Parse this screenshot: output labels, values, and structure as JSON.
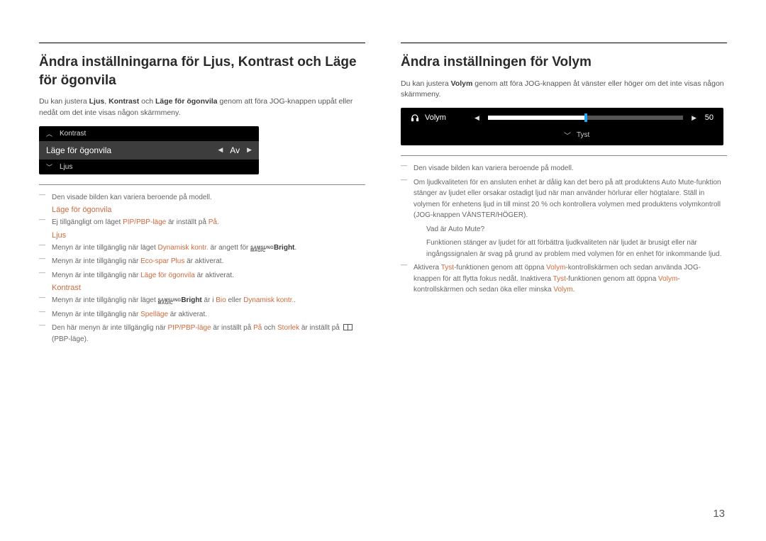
{
  "page_number": "13",
  "left": {
    "heading": "Ändra inställningarna för Ljus, Kontrast och Läge för ögonvila",
    "intro_parts": {
      "a": "Du kan justera ",
      "ljus": "Ljus",
      "sep1": ", ",
      "kontrast": "Kontrast",
      "sep2": " och ",
      "lfo": "Läge för ögonvila",
      "b": " genom att föra JOG-knappen uppåt eller nedåt om det inte visas någon skärmmeny."
    },
    "osd": {
      "top": "Kontrast",
      "mid": "Läge för ögonvila",
      "mid_val": "Av",
      "bottom": "Ljus"
    },
    "note_same": "Den visade bilden kan variera beroende på modell.",
    "sh_eye": "Läge för ögonvila",
    "eye_note": {
      "a": "Ej tillgängligt om läget ",
      "hl1": "PIP/PBP-läge",
      "b": " är inställt på ",
      "hl2": "På",
      "c": "."
    },
    "sh_ljus": "Ljus",
    "ljus_n1": {
      "a": "Menyn är inte tillgänglig när läget ",
      "hl1": "Dynamisk kontr.",
      "b": " är angett för ",
      "brand": "Bright",
      "c": "."
    },
    "ljus_n2": {
      "a": "Menyn är inte tillgänglig när ",
      "hl1": "Eco-spar Plus",
      "b": " är aktiverat."
    },
    "ljus_n3": {
      "a": "Menyn är inte tillgänglig när ",
      "hl1": "Läge för ögonvila",
      "b": " är aktiverat."
    },
    "sh_kon": "Kontrast",
    "kon_n1": {
      "a": "Menyn är inte tillgänglig när läget ",
      "brand": "Bright",
      "b": " är i ",
      "hl1": "Bio",
      "c": " eller ",
      "hl2": "Dynamisk kontr.",
      "d": "."
    },
    "kon_n2": {
      "a": "Menyn är inte tillgänglig när ",
      "hl1": "Spelläge",
      "b": " är aktiverat."
    },
    "kon_n3": {
      "a": "Den här menyn är inte tillgänglig när ",
      "hl1": "PIP/PBP-läge",
      "b": " är inställt på ",
      "hl2": "På",
      "c": " och ",
      "hl3": "Storlek",
      "d": " är inställt på ",
      "e": " (PBP-läge)."
    }
  },
  "right": {
    "heading": "Ändra inställningen för Volym",
    "intro_parts": {
      "a": "Du kan justera ",
      "hl": "Volym",
      "b": " genom att föra JOG-knappen åt vänster eller höger om det inte visas någon skärmmeny."
    },
    "osd": {
      "label": "Volym",
      "value": "50",
      "mute": "Tyst"
    },
    "note_same": "Den visade bilden kan variera beroende på modell.",
    "n2": "Om ljudkvaliteten för en ansluten enhet är dålig kan det bero på att produktens Auto Mute-funktion stänger av ljudet eller orsakar ostadigt ljud när man använder hörlurar eller högtalare. Ställ in volymen för enhetens ljud in till minst 20 % och kontrollera volymen med produktens volymkontroll (JOG-knappen VÄNSTER/HÖGER).",
    "n2a": "Vad är Auto Mute?",
    "n2b": "Funktionen stänger av ljudet för att förbättra ljudkvaliteten när ljudet är brusigt eller när ingångssignalen är svag på grund av problem med volymen för en enhet för inkommande ljud.",
    "n3": {
      "a": "Aktivera ",
      "hl1": "Tyst",
      "b": "-funktionen genom att öppna ",
      "hl2": "Volym",
      "c": "-kontrollskärmen och sedan använda JOG-knappen för att flytta fokus nedåt. Inaktivera ",
      "hl3": "Tyst",
      "d": "-funktionen genom att öppna ",
      "hl4": "Volym",
      "e": "-kontrollskärmen och sedan öka eller minska ",
      "hl5": "Volym",
      "f": "."
    }
  }
}
